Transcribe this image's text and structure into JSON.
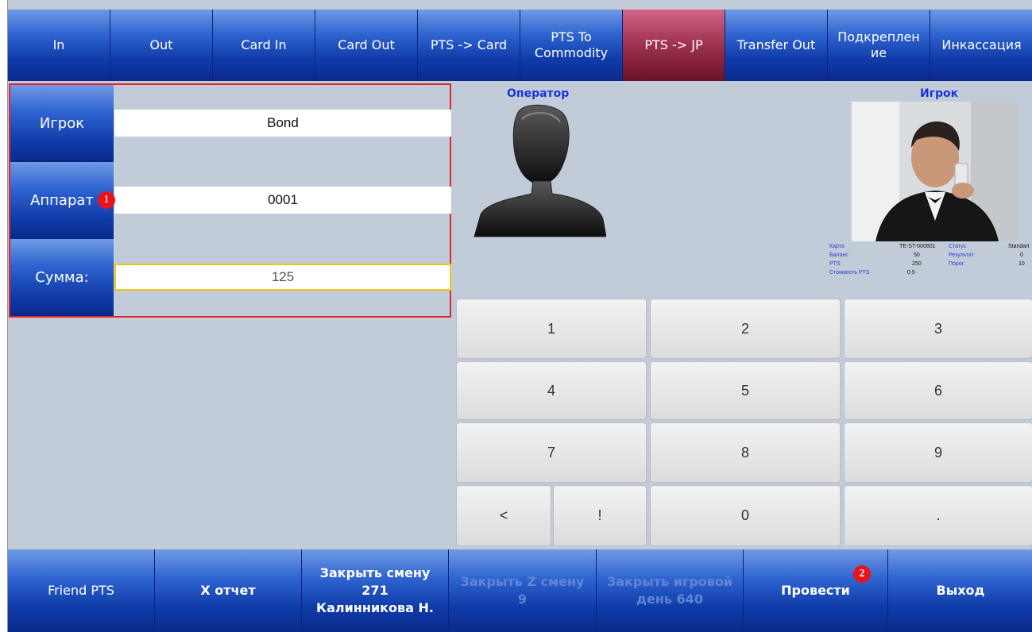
{
  "top_tabs": [
    "In",
    "Out",
    "Card In",
    "Card Out",
    "PTS -> Card",
    "PTS To\nCommodity",
    "PTS -> JP",
    "Transfer Out",
    "Подкреплен\nие",
    "Инкассация"
  ],
  "active_tab": "PTS -> JP",
  "form": {
    "player_label": "Игрок",
    "player_value": "Bond",
    "machine_label": "Аппарат",
    "machine_value": "0001",
    "amount_label": "Сумма:",
    "amount_value": "125"
  },
  "badges": {
    "one": "1",
    "two": "2"
  },
  "operator": {
    "title": "Оператор"
  },
  "player": {
    "title": "Игрок",
    "info": {
      "card_label": "Карта",
      "card_value": "TE-ST-000801",
      "status_label": "Статус",
      "status_value": "Standart",
      "balance_label": "Баланс",
      "balance_value": "50",
      "result_label": "Результат",
      "result_value": "0",
      "pts_label": "PTS",
      "pts_value": "250",
      "threshold_label": "Порог",
      "threshold_value": "10",
      "pts_cost_label": "Стоимость PTS",
      "pts_cost_value": "0.5"
    }
  },
  "keypad": {
    "k1": "1",
    "k2": "2",
    "k3": "3",
    "k4": "4",
    "k5": "5",
    "k6": "6",
    "k7": "7",
    "k8": "8",
    "k9": "9",
    "back": "<",
    "bang": "!",
    "k0": "0",
    "dot": "."
  },
  "bottom": {
    "friend_pts": "Friend PTS",
    "x_report": "X отчет",
    "close_shift_l1": "Закрыть смену",
    "close_shift_l2": "271",
    "close_shift_l3": "Калинникова Н.",
    "close_z_l1": "Закрыть Z смену",
    "close_z_l2": "9",
    "close_day_l1": "Закрыть игровой",
    "close_day_l2": "день 640",
    "post": "Провести",
    "exit": "Выход"
  },
  "colors": {
    "button_blue": "#1f4fc0",
    "active_tab": "#8a2440",
    "highlight_border": "#e0262f",
    "badge": "#e8141c",
    "title_blue": "#1a33d8"
  }
}
